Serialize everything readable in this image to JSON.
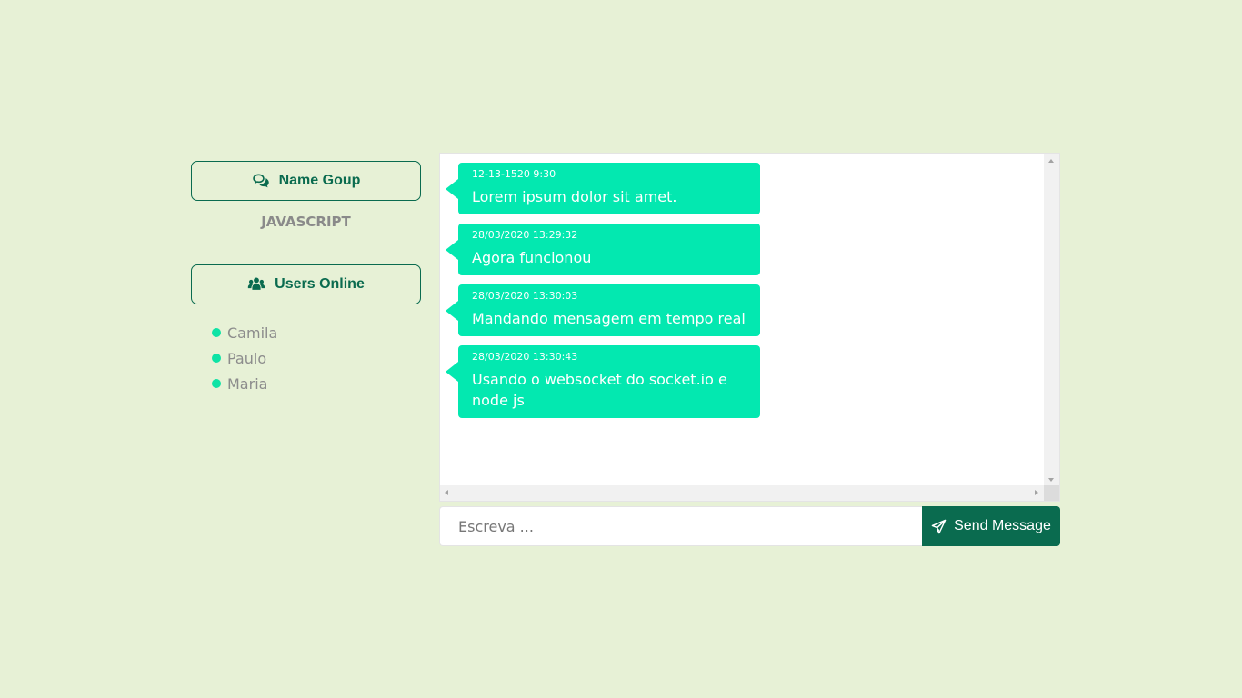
{
  "sidebar": {
    "group_button_label": "Name Goup",
    "group_name": "JAVASCRIPT",
    "users_button_label": "Users Online",
    "users": [
      "Camila",
      "Paulo",
      "Maria"
    ]
  },
  "messages": [
    {
      "time": "12-13-1520 9:30",
      "text": "Lorem ipsum dolor sit amet."
    },
    {
      "time": "28/03/2020 13:29:32",
      "text": "Agora funcionou"
    },
    {
      "time": "28/03/2020 13:30:03",
      "text": "Mandando mensagem em tempo real"
    },
    {
      "time": "28/03/2020 13:30:43",
      "text": "Usando o websocket do socket.io e node js"
    }
  ],
  "composer": {
    "placeholder": "Escreva ...",
    "send_label": "Send Message"
  },
  "colors": {
    "background": "#e7f1d6",
    "primary": "#0a6b4f",
    "bubble": "#03e8b0",
    "online_dot": "#0ee3a5"
  },
  "icons": {
    "group": "comments-icon",
    "users": "users-icon",
    "send": "paper-plane-icon"
  }
}
